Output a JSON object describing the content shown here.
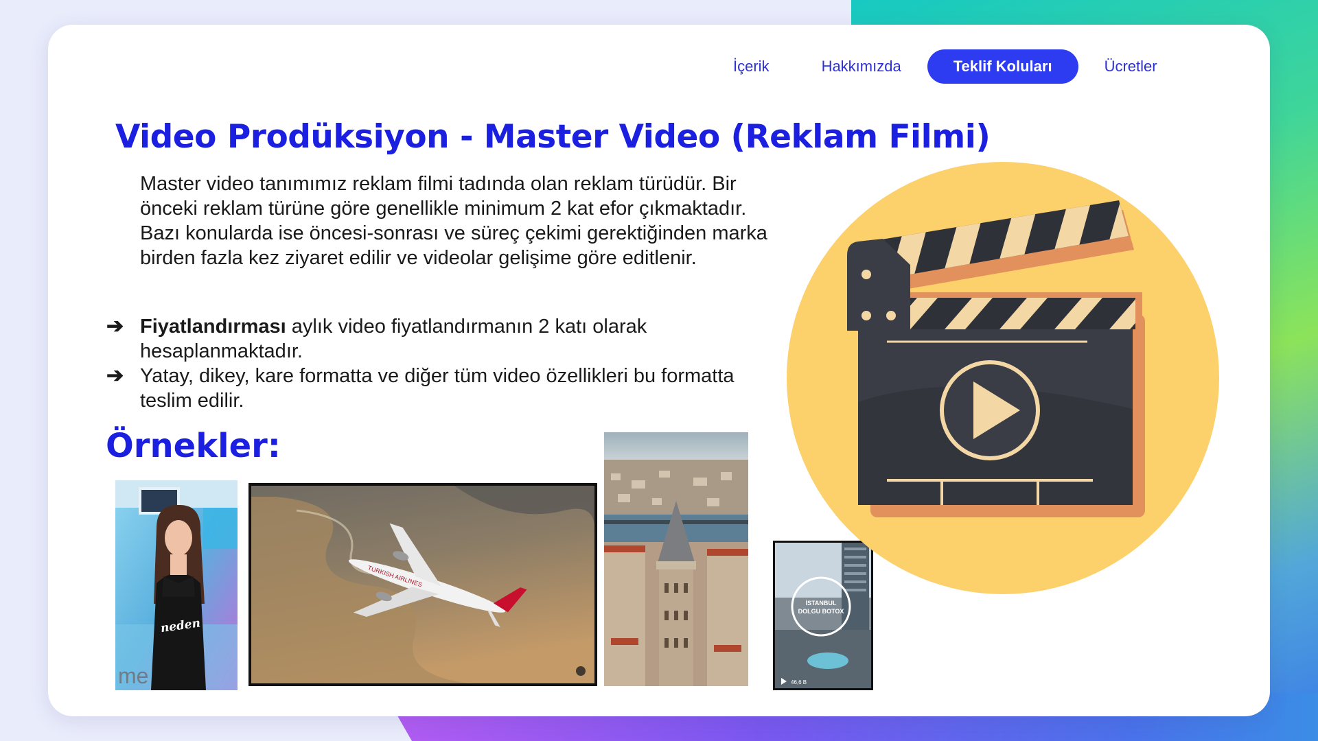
{
  "nav": {
    "items": [
      {
        "label": "İçerik",
        "active": false
      },
      {
        "label": "Hakkımızda",
        "active": false
      },
      {
        "label": "Teklif Koluları",
        "active": true
      },
      {
        "label": "Ücretler",
        "active": false
      }
    ]
  },
  "title": "Video Prodüksiyon - Master Video (Reklam Filmi)",
  "intro": "Master video tanımımız reklam filmi tadında olan reklam türüdür. Bir önceki reklam türüne göre genellikle minimum 2 kat efor çıkmaktadır. Bazı konularda ise öncesi-sonrası ve süreç çekimi gerektiğinden marka birden fazla kez ziyaret edilir ve videolar gelişime göre editlenir.",
  "bullets": [
    {
      "bold": "Fiyatlandırması",
      "text": " aylık video fiyatlandırmanın 2 katı olarak hesaplanmaktadır."
    },
    {
      "bold": "",
      "text": "Yatay, dikey, kare formatta ve diğer tüm video özellikleri bu formatta teslim edilir."
    }
  ],
  "bullet_arrow": "➔",
  "examples_title": "Örnekler:",
  "thumbnails": {
    "presenter_caption": "neden",
    "istanbul_line1": "İSTANBUL",
    "istanbul_line2": "DOLGU BOTOX",
    "view_count": "46,6 B"
  },
  "colors": {
    "accent": "#1b1fe0",
    "nav_active_bg": "#2d3cf0",
    "clapper_circle": "#fcd06a",
    "clapper_body": "#3b3d46",
    "clapper_accent": "#f3d8a6"
  }
}
